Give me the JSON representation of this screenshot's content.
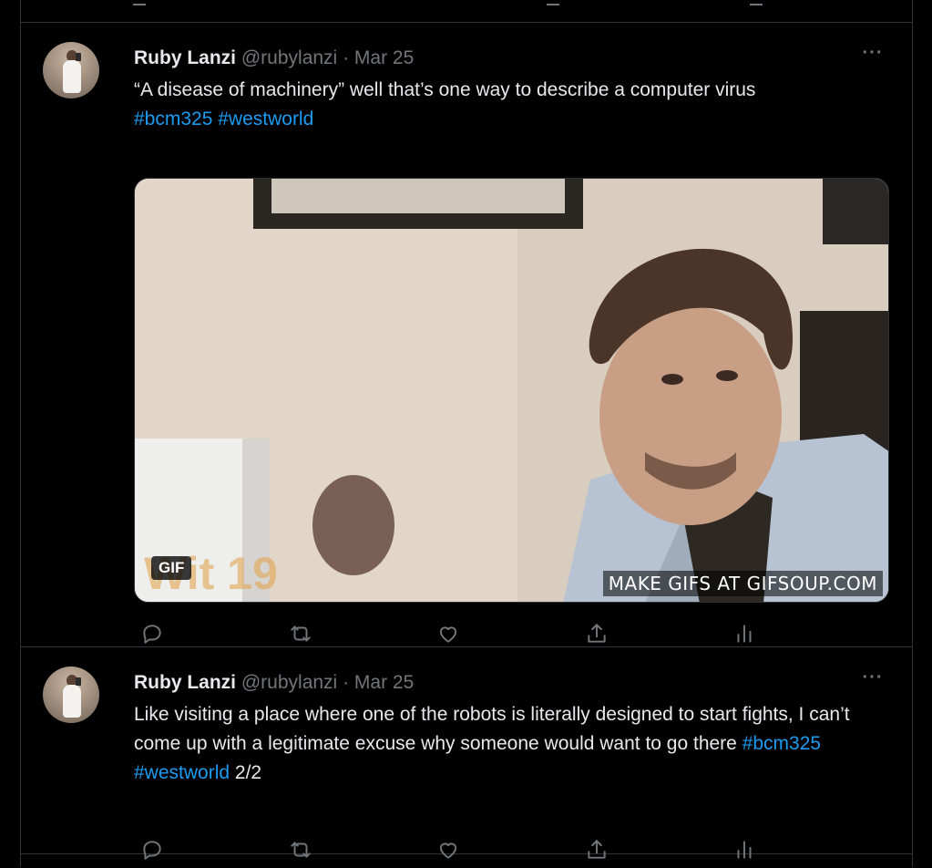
{
  "colors": {
    "background": "#000000",
    "text_primary": "#e7e9ea",
    "text_secondary": "#71767b",
    "link": "#1d9bf0",
    "divider": "#2f3336"
  },
  "tweets": [
    {
      "author_name": "Ruby Lanzi",
      "handle": "@rubylanzi",
      "separator": "·",
      "date": "Mar 25",
      "more_label": "···",
      "text_plain": "“A disease of machinery” well that’s one way to describe a computer virus",
      "hashtags": [
        "#bcm325",
        "#westworld"
      ],
      "media": {
        "badge": "GIF",
        "watermark": "MAKE GIFS AT GIFSOUP.COM"
      },
      "actions": [
        "reply-icon",
        "retweet-icon",
        "like-icon",
        "share-icon",
        "analytics-icon"
      ]
    },
    {
      "author_name": "Ruby Lanzi",
      "handle": "@rubylanzi",
      "separator": "·",
      "date": "Mar 25",
      "more_label": "···",
      "text_plain": "Like visiting a place where one of the robots is literally designed to start fights, I can’t come up with a legitimate excuse why someone would want to go there",
      "hashtags": [
        "#bcm325",
        "#westworld"
      ],
      "suffix": "2/2",
      "actions": [
        "reply-icon",
        "retweet-icon",
        "like-icon",
        "share-icon",
        "analytics-icon"
      ]
    }
  ]
}
